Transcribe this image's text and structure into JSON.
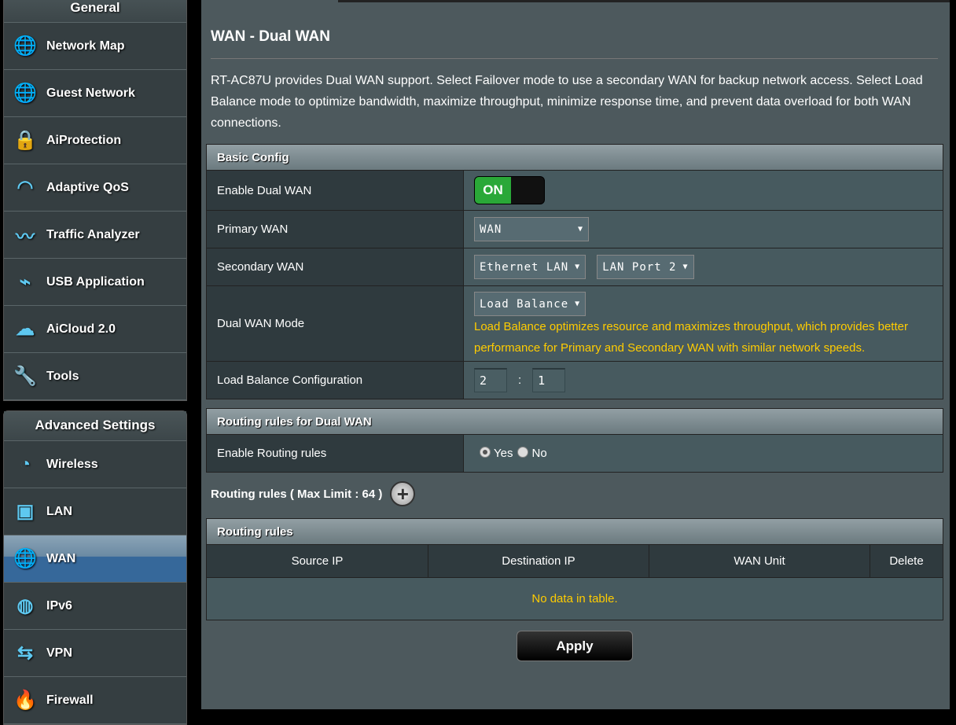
{
  "sidebar": {
    "general_title": "General",
    "general_items": [
      {
        "label": "Network Map",
        "icon": "globe-pin-icon"
      },
      {
        "label": "Guest Network",
        "icon": "guest-network-icon"
      },
      {
        "label": "AiProtection",
        "icon": "shield-lock-icon"
      },
      {
        "label": "Adaptive QoS",
        "icon": "speedometer-icon"
      },
      {
        "label": "Traffic Analyzer",
        "icon": "traffic-icon"
      },
      {
        "label": "USB Application",
        "icon": "usb-icon"
      },
      {
        "label": "AiCloud 2.0",
        "icon": "cloud-icon"
      },
      {
        "label": "Tools",
        "icon": "wrench-icon"
      }
    ],
    "advanced_title": "Advanced Settings",
    "advanced_items": [
      {
        "label": "Wireless",
        "icon": "wireless-icon"
      },
      {
        "label": "LAN",
        "icon": "lan-icon"
      },
      {
        "label": "WAN",
        "icon": "globe-icon",
        "active": true
      },
      {
        "label": "IPv6",
        "icon": "ipv6-icon"
      },
      {
        "label": "VPN",
        "icon": "vpn-icon"
      },
      {
        "label": "Firewall",
        "icon": "firewall-icon"
      }
    ]
  },
  "page": {
    "title": "WAN - Dual WAN",
    "description": "RT-AC87U provides Dual WAN support. Select Failover mode to use a secondary WAN for backup network access. Select Load Balance mode to optimize bandwidth, maximize throughput, minimize response time, and prevent data overload for both WAN connections."
  },
  "basic": {
    "title": "Basic Config",
    "enable_label": "Enable Dual WAN",
    "toggle": "ON",
    "primary_label": "Primary WAN",
    "primary_value": "WAN",
    "secondary_label": "Secondary WAN",
    "secondary_value": "Ethernet LAN",
    "secondary_port": "LAN Port 2",
    "mode_label": "Dual WAN Mode",
    "mode_value": "Load Balance",
    "mode_note": "Load Balance optimizes resource and maximizes throughput, which provides better performance for Primary and Secondary WAN with similar network speeds.",
    "lb_label": "Load Balance Configuration",
    "lb_primary": "2",
    "lb_sep": ":",
    "lb_secondary": "1"
  },
  "routing": {
    "title": "Routing rules for Dual WAN",
    "enable_label": "Enable Routing rules",
    "yes": "Yes",
    "no": "No",
    "selected": "Yes",
    "limit_label": "Routing rules ( Max Limit : 64 )",
    "table_title": "Routing rules",
    "columns": [
      "Source IP",
      "Destination IP",
      "WAN Unit",
      "Delete"
    ],
    "empty": "No data in table."
  },
  "apply_label": "Apply",
  "colors": {
    "accent": "#ffcc00",
    "toggle_on": "#2aa838",
    "active_nav": "#36689a"
  }
}
